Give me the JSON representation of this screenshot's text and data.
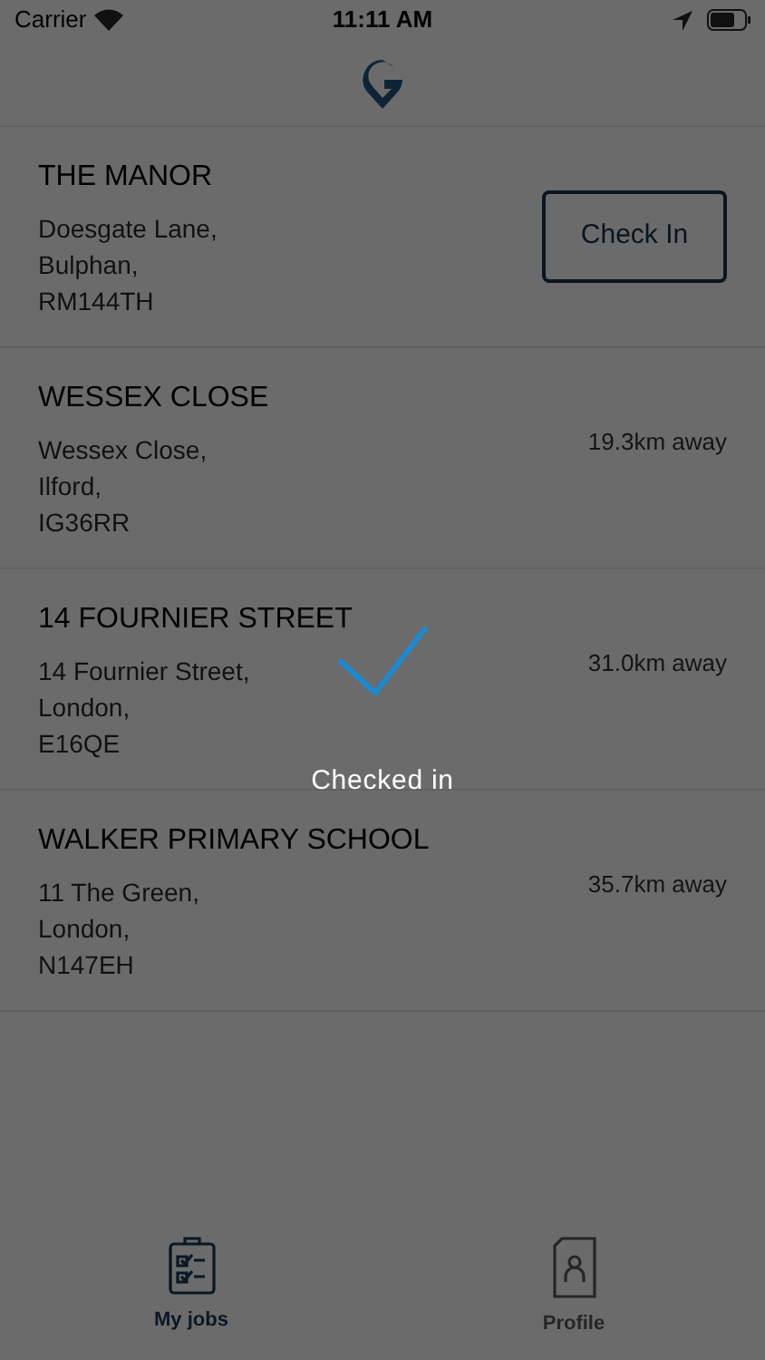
{
  "status_bar": {
    "carrier": "Carrier",
    "time": "11:11 AM"
  },
  "jobs": [
    {
      "kind": "button",
      "name": "THE MANOR",
      "address": [
        "Doesgate Lane,",
        "Bulphan,",
        "RM144TH"
      ],
      "action": "Check In"
    },
    {
      "kind": "distance",
      "name": "WESSEX CLOSE",
      "address": [
        "Wessex Close,",
        "Ilford,",
        "IG36RR"
      ],
      "action": "19.3km away"
    },
    {
      "kind": "distance",
      "name": "14 FOURNIER STREET",
      "address": [
        "14 Fournier Street,",
        "London,",
        "E16QE"
      ],
      "action": "31.0km away"
    },
    {
      "kind": "distance",
      "name": "WALKER PRIMARY SCHOOL",
      "address": [
        "11 The Green,",
        "London,",
        "N147EH"
      ],
      "action": "35.7km away"
    }
  ],
  "toast": {
    "message": "Checked in"
  },
  "tabs": [
    {
      "kind": "jobs",
      "label": "My jobs",
      "selected": true
    },
    {
      "kind": "profile",
      "label": "Profile",
      "selected": false
    }
  ]
}
